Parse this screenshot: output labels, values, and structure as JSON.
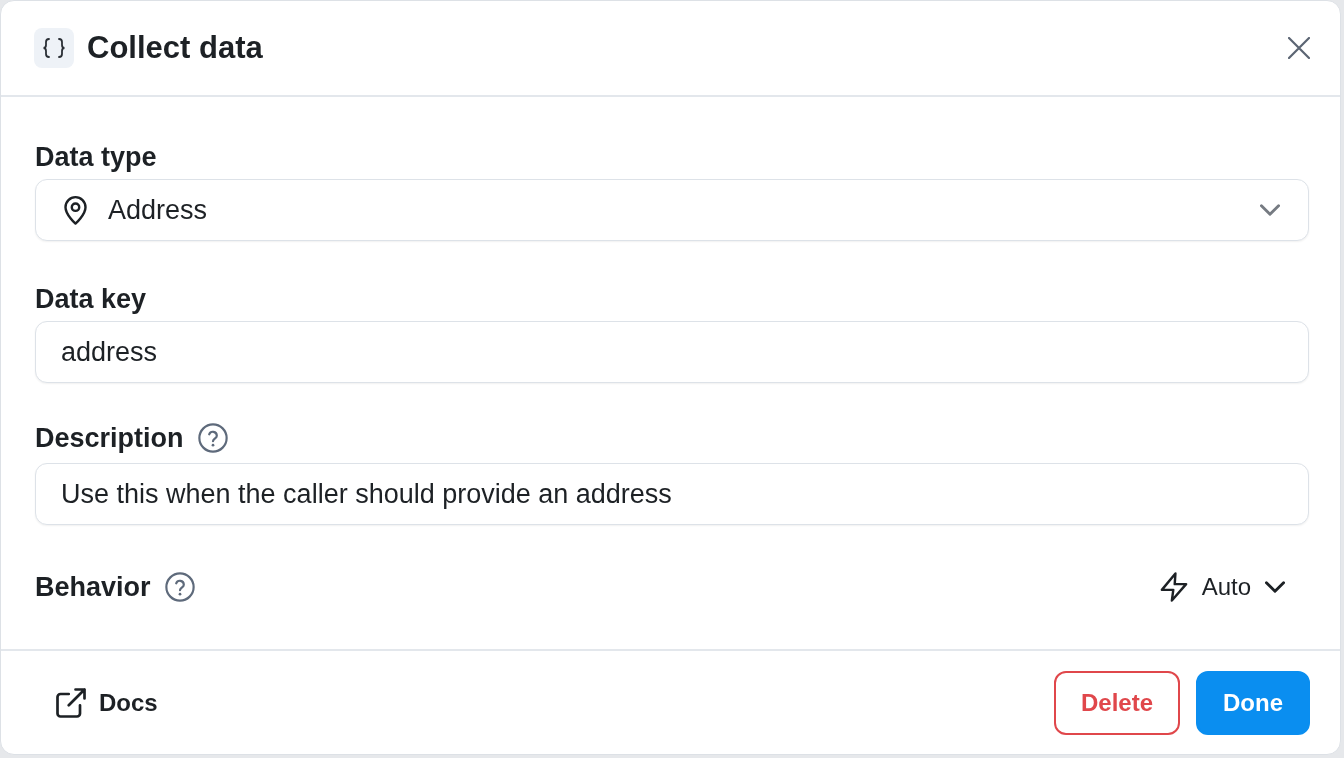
{
  "dialog": {
    "title": "Collect data"
  },
  "fields": [
    {
      "kind": "select",
      "label": "Data type",
      "value": "Address",
      "help": false
    },
    {
      "kind": "text",
      "label": "Data key",
      "value": "address",
      "help": false
    },
    {
      "kind": "text",
      "label": "Description",
      "value": "Use this when the caller should provide an address",
      "help": true
    }
  ],
  "behavior": {
    "label": "Behavior",
    "help": true,
    "value": "Auto"
  },
  "footer": {
    "link": "Docs",
    "buttons": [
      {
        "label": "Delete",
        "kind": "danger"
      },
      {
        "label": "Done",
        "kind": "primary"
      }
    ]
  }
}
